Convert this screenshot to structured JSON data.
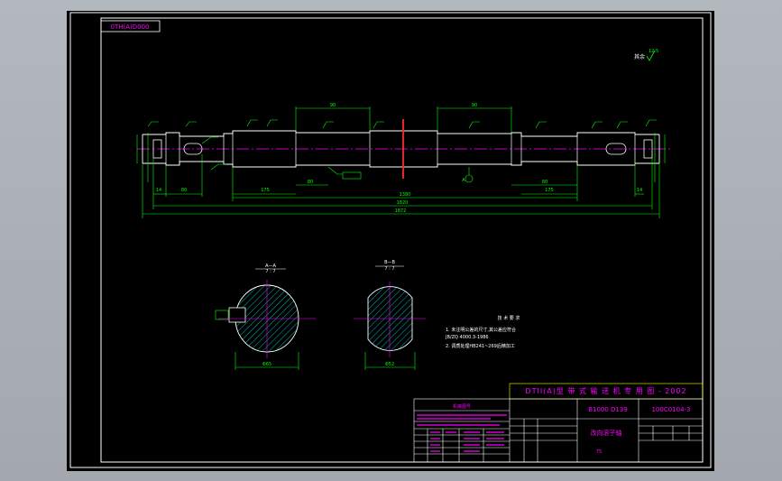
{
  "drawing": {
    "code_box": "0TH(A)D000",
    "roughness_note": "其余",
    "roughness_value": "12.5",
    "colors": {
      "frame": "#ffffff",
      "geometry": "#ffffff",
      "dimension": "#00ff00",
      "centerline": "#ff00ff",
      "hatch": "#00ffff",
      "cut_mark": "#ff2a2a",
      "titleblock": "#ffff00",
      "text_accent": "#ff00ff"
    },
    "shaft": {
      "overall_length": "1872",
      "span_length": "1820",
      "center_length": "1380",
      "section_mark": "A"
    },
    "sections": [
      {
        "label": "A—A",
        "scale": "7 : 7",
        "width_dim": "Φ65"
      },
      {
        "label": "B—B",
        "scale": "7 : 7",
        "width_dim": "Φ52"
      }
    ],
    "notes": {
      "title": "技 术 要 求",
      "lines": [
        "1. 未注明公差的尺寸,其公差应符合",
        "   JB/ZQ 4000.3-1986",
        "2. 调质处理HB241~269后精加工"
      ]
    },
    "titleblock": {
      "series": "DTII(A)型  带 式 输 送 机 专 用 图 - 2002",
      "spec": "B1000 D139",
      "drawing_no": "100C0104-3",
      "part_name": "改向滚子轴",
      "sheet": "75",
      "table_header": "机械图号"
    }
  }
}
